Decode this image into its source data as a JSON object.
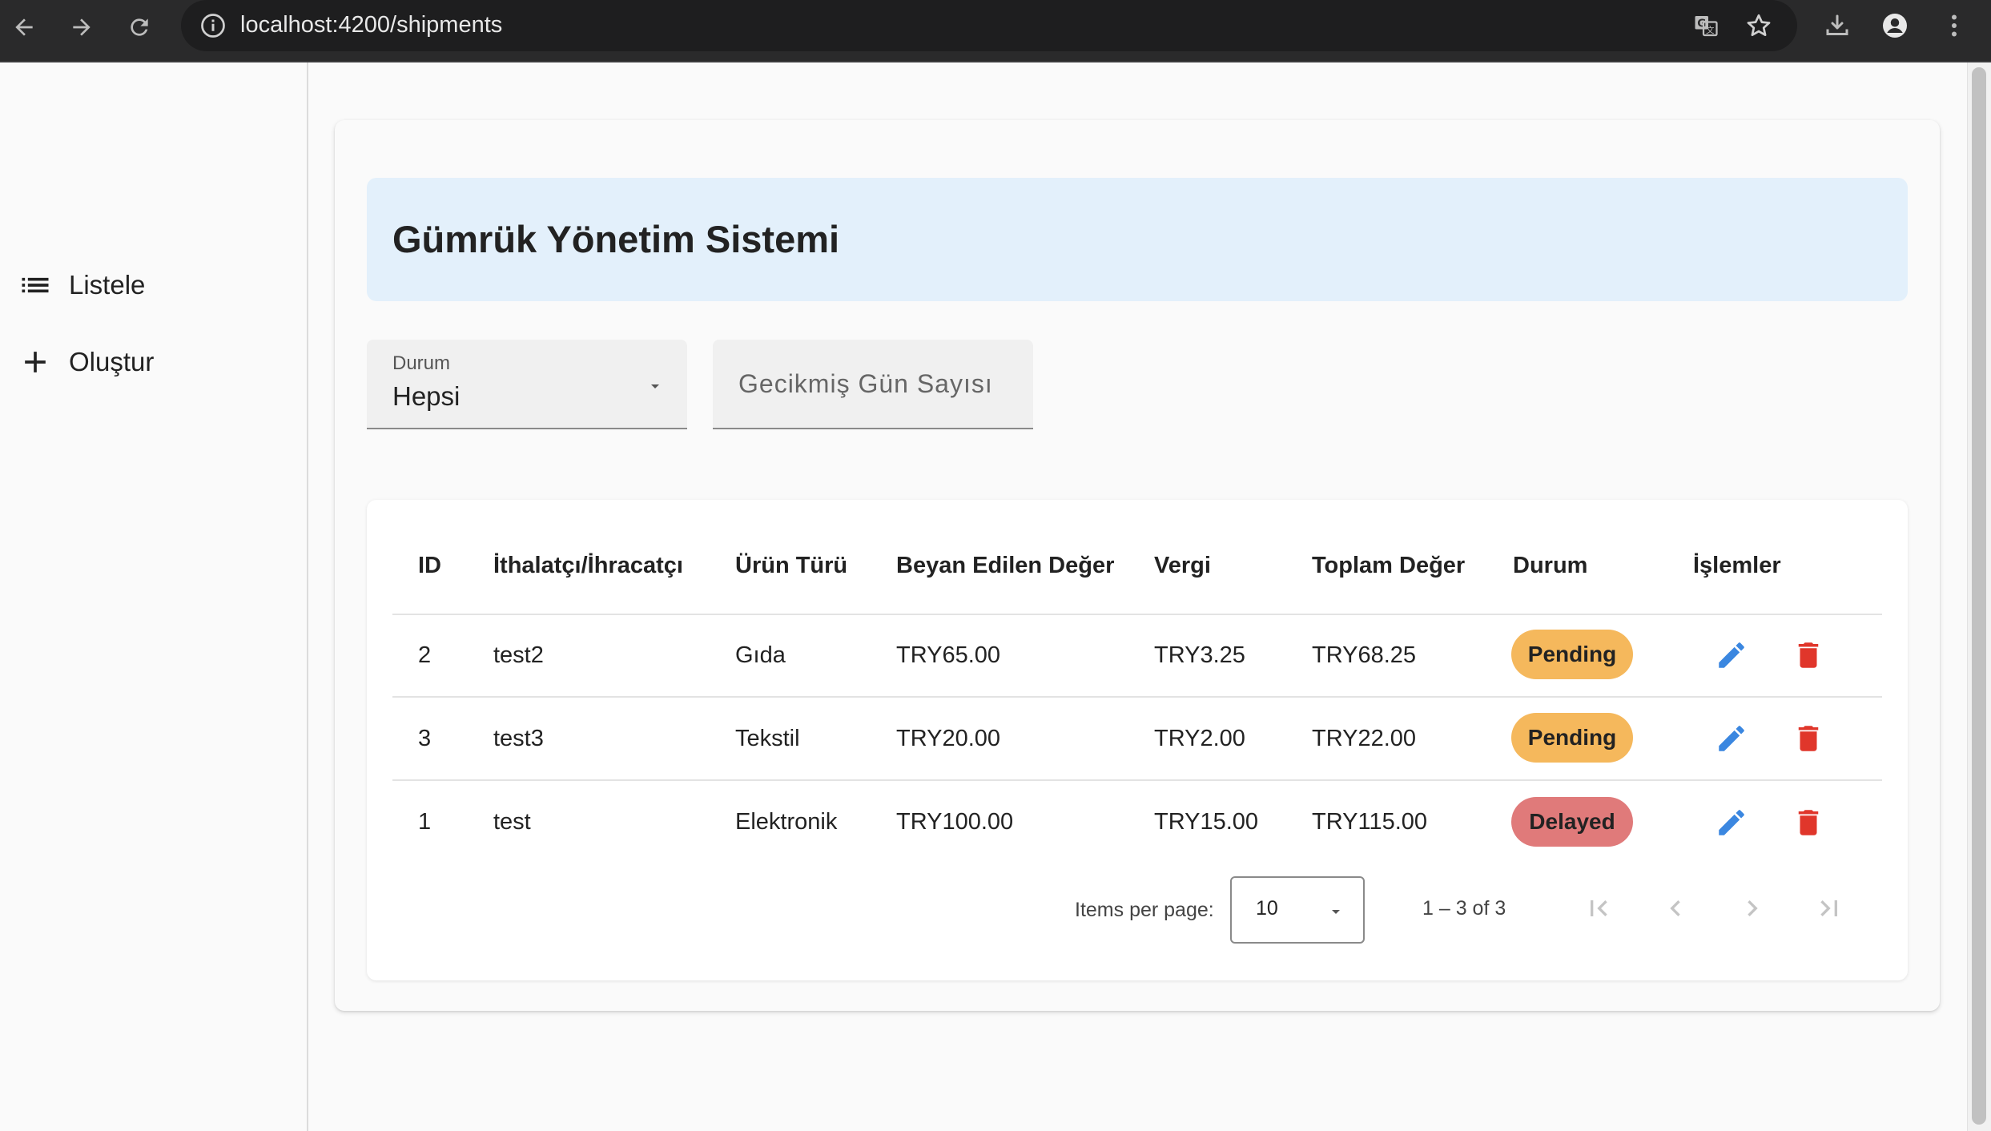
{
  "browser": {
    "url": "localhost:4200/shipments"
  },
  "sidebar": {
    "items": [
      {
        "label": "Listele",
        "icon": "list-icon"
      },
      {
        "label": "Oluştur",
        "icon": "plus-icon"
      }
    ]
  },
  "main": {
    "title": "Gümrük Yönetim Sistemi",
    "filters": {
      "status_label": "Durum",
      "status_value": "Hepsi",
      "delay_placeholder": "Gecikmiş Gün Sayısı",
      "delay_value": ""
    },
    "table": {
      "columns": [
        "ID",
        "İthalatçı/İhracatçı",
        "Ürün Türü",
        "Beyan Edilen Değer",
        "Vergi",
        "Toplam Değer",
        "Durum",
        "İşlemler"
      ],
      "rows": [
        {
          "id": "2",
          "party": "test2",
          "product": "Gıda",
          "declared": "TRY65.00",
          "tax": "TRY3.25",
          "total": "TRY68.25",
          "status": "Pending"
        },
        {
          "id": "3",
          "party": "test3",
          "product": "Tekstil",
          "declared": "TRY20.00",
          "tax": "TRY2.00",
          "total": "TRY22.00",
          "status": "Pending"
        },
        {
          "id": "1",
          "party": "test",
          "product": "Elektronik",
          "declared": "TRY100.00",
          "tax": "TRY15.00",
          "total": "TRY115.00",
          "status": "Delayed"
        }
      ]
    },
    "paginator": {
      "items_per_page_label": "Items per page:",
      "page_size": "10",
      "range": "1 – 3 of 3"
    }
  },
  "colors": {
    "banner_bg": "#e3f0fb",
    "pending": "#f5b85c",
    "delayed": "#e07a7a",
    "edit_icon": "#3b87e0",
    "delete_icon": "#e0362b"
  }
}
